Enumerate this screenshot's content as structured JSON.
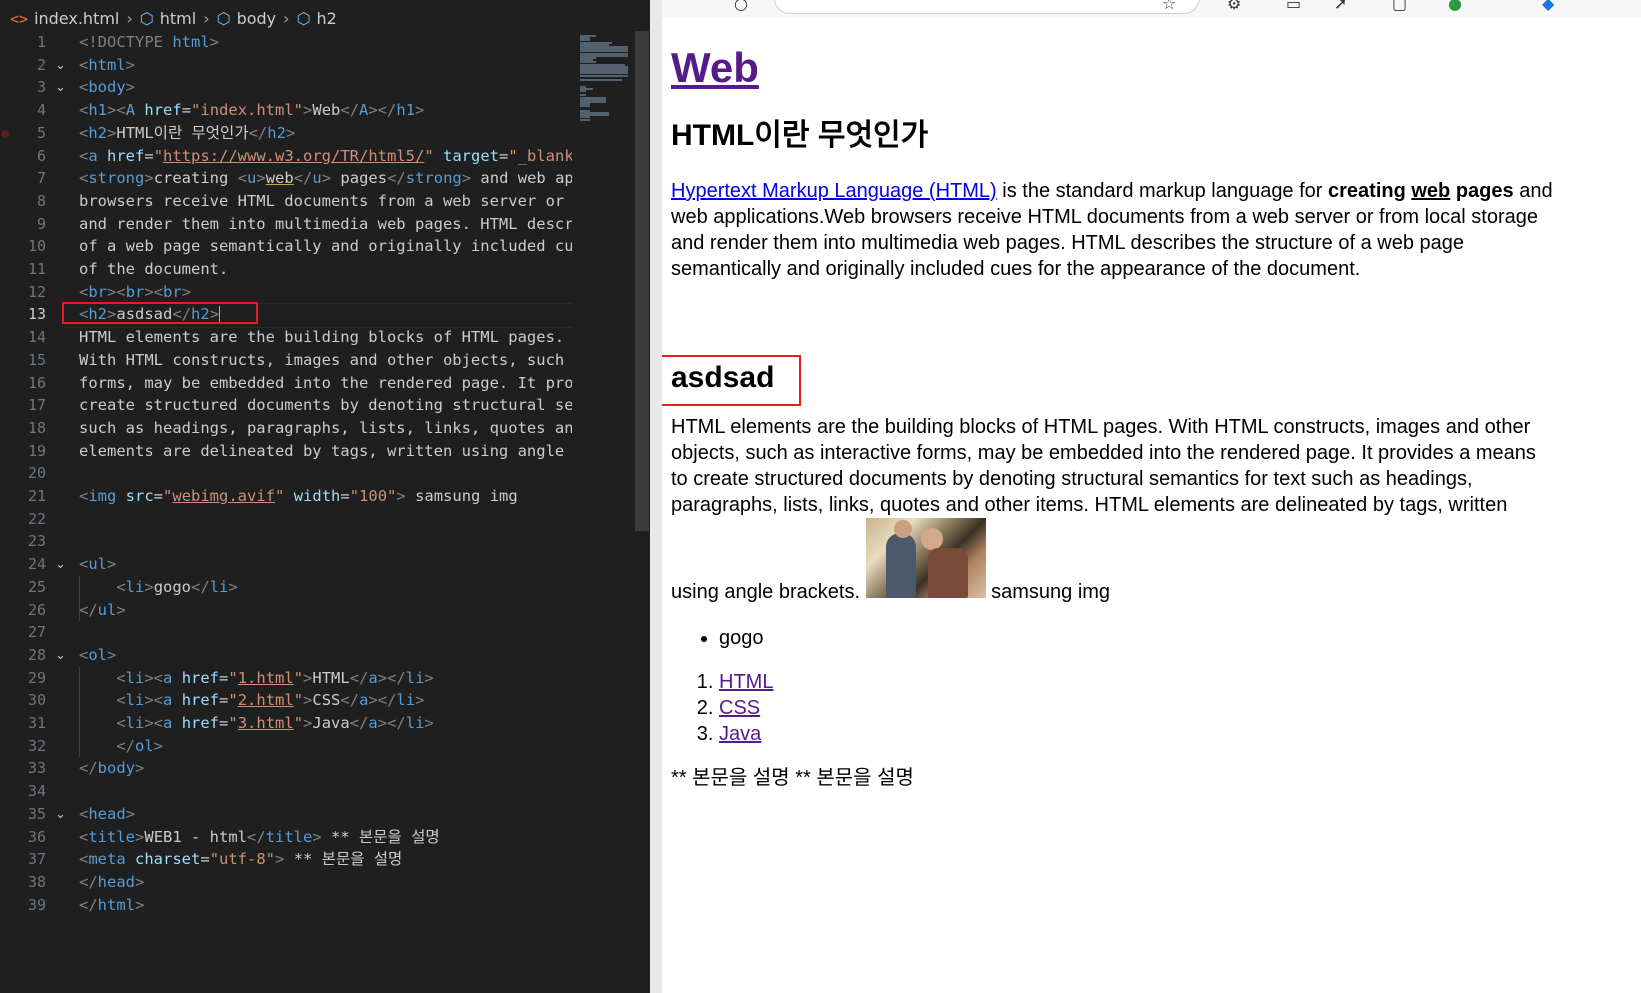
{
  "breadcrumb": [
    "index.html",
    "html",
    "body",
    "h2"
  ],
  "editor": {
    "lines": [
      {
        "n": "1",
        "fold": "",
        "tokens": [
          [
            "brk",
            "<!DOCTYPE "
          ],
          [
            "tag",
            "html"
          ],
          [
            "brk",
            ">"
          ]
        ]
      },
      {
        "n": "2",
        "fold": "v",
        "tokens": [
          [
            "brk",
            "<"
          ],
          [
            "tag",
            "html"
          ],
          [
            "brk",
            ">"
          ]
        ]
      },
      {
        "n": "3",
        "fold": "v",
        "tokens": [
          [
            "brk",
            "<"
          ],
          [
            "tag",
            "body"
          ],
          [
            "brk",
            ">"
          ]
        ]
      },
      {
        "n": "4",
        "fold": "",
        "tokens": [
          [
            "brk",
            "<"
          ],
          [
            "tag",
            "h1"
          ],
          [
            "brk",
            "><"
          ],
          [
            "tag",
            "A "
          ],
          [
            "attr",
            "href"
          ],
          [
            "txt",
            "="
          ],
          [
            "str",
            "\"index.html\""
          ],
          [
            "brk",
            ">"
          ],
          [
            "txt",
            "Web"
          ],
          [
            "brk",
            "</"
          ],
          [
            "tag",
            "A"
          ],
          [
            "brk",
            "></"
          ],
          [
            "tag",
            "h1"
          ],
          [
            "brk",
            ">"
          ]
        ]
      },
      {
        "n": "5",
        "fold": "",
        "bp": true,
        "tokens": [
          [
            "brk",
            "<"
          ],
          [
            "tag",
            "h2"
          ],
          [
            "brk",
            ">"
          ],
          [
            "txt",
            "HTML이란 무엇인가"
          ],
          [
            "brk",
            "</"
          ],
          [
            "tag",
            "h2"
          ],
          [
            "brk",
            ">"
          ]
        ]
      },
      {
        "n": "6",
        "fold": "",
        "tokens": [
          [
            "brk",
            "<"
          ],
          [
            "tag",
            "a "
          ],
          [
            "attr",
            "href"
          ],
          [
            "txt",
            "="
          ],
          [
            "str",
            "\""
          ],
          [
            "link",
            "https://www.w3.org/TR/html5/"
          ],
          [
            "str",
            "\""
          ],
          [
            "txt",
            " "
          ],
          [
            "attr",
            "target"
          ],
          [
            "txt",
            "="
          ],
          [
            "str",
            "\"_blank\""
          ]
        ]
      },
      {
        "n": "7",
        "fold": "",
        "tokens": [
          [
            "brk",
            "<"
          ],
          [
            "tag",
            "strong"
          ],
          [
            "brk",
            ">"
          ],
          [
            "txt",
            "creating "
          ],
          [
            "brk",
            "<"
          ],
          [
            "tag",
            "u"
          ],
          [
            "brk",
            ">"
          ],
          [
            "ul",
            "web"
          ],
          [
            "brk",
            "</"
          ],
          [
            "tag",
            "u"
          ],
          [
            "brk",
            ">"
          ],
          [
            "txt",
            " pages"
          ],
          [
            "brk",
            "</"
          ],
          [
            "tag",
            "strong"
          ],
          [
            "brk",
            ">"
          ],
          [
            "txt",
            " and web app"
          ]
        ]
      },
      {
        "n": "8",
        "fold": "",
        "tokens": [
          [
            "txt",
            "browsers receive HTML documents from a web server or f"
          ]
        ]
      },
      {
        "n": "9",
        "fold": "",
        "tokens": [
          [
            "txt",
            "and render them into multimedia web pages. HTML descri"
          ]
        ]
      },
      {
        "n": "10",
        "fold": "",
        "tokens": [
          [
            "txt",
            "of a web page semantically and originally included cue"
          ]
        ]
      },
      {
        "n": "11",
        "fold": "",
        "tokens": [
          [
            "txt",
            "of the document."
          ]
        ]
      },
      {
        "n": "12",
        "fold": "",
        "tokens": [
          [
            "brk",
            "<"
          ],
          [
            "tag",
            "br"
          ],
          [
            "brk",
            "><"
          ],
          [
            "tag",
            "br"
          ],
          [
            "brk",
            "><"
          ],
          [
            "tag",
            "br"
          ],
          [
            "brk",
            ">"
          ]
        ]
      },
      {
        "n": "13",
        "fold": "",
        "active": true,
        "tokens": [
          [
            "brk",
            "<"
          ],
          [
            "tag",
            "h2"
          ],
          [
            "brk",
            ">"
          ],
          [
            "txt",
            "asdsad"
          ],
          [
            "brk",
            "</"
          ],
          [
            "tag",
            "h2"
          ],
          [
            "brk",
            ">"
          ]
        ]
      },
      {
        "n": "14",
        "fold": "",
        "tokens": [
          [
            "txt",
            "HTML elements are the building blocks of HTML pages."
          ]
        ]
      },
      {
        "n": "15",
        "fold": "",
        "tokens": [
          [
            "txt",
            "With HTML constructs, images and other objects, such a"
          ]
        ]
      },
      {
        "n": "16",
        "fold": "",
        "tokens": [
          [
            "txt",
            "forms, may be embedded into the rendered page. It prov"
          ]
        ]
      },
      {
        "n": "17",
        "fold": "",
        "tokens": [
          [
            "txt",
            "create structured documents by denoting structural sem"
          ]
        ]
      },
      {
        "n": "18",
        "fold": "",
        "tokens": [
          [
            "txt",
            "such as headings, paragraphs, lists, links, quotes and"
          ]
        ]
      },
      {
        "n": "19",
        "fold": "",
        "tokens": [
          [
            "txt",
            "elements are delineated by tags, written using angle b"
          ]
        ]
      },
      {
        "n": "20",
        "fold": "",
        "tokens": []
      },
      {
        "n": "21",
        "fold": "",
        "tokens": [
          [
            "brk",
            "<"
          ],
          [
            "tag",
            "img "
          ],
          [
            "attr",
            "src"
          ],
          [
            "txt",
            "="
          ],
          [
            "str",
            "\""
          ],
          [
            "link",
            "webimg.avif"
          ],
          [
            "str",
            "\""
          ],
          [
            "txt",
            " "
          ],
          [
            "attr",
            "width"
          ],
          [
            "txt",
            "="
          ],
          [
            "str",
            "\"100\""
          ],
          [
            "brk",
            ">"
          ],
          [
            "txt",
            " samsung img"
          ]
        ]
      },
      {
        "n": "22",
        "fold": "",
        "tokens": []
      },
      {
        "n": "23",
        "fold": "",
        "tokens": []
      },
      {
        "n": "24",
        "fold": "v",
        "tokens": [
          [
            "brk",
            "<"
          ],
          [
            "tag",
            "ul"
          ],
          [
            "brk",
            ">"
          ]
        ]
      },
      {
        "n": "25",
        "fold": "",
        "tokens": [
          [
            "txt",
            "    "
          ],
          [
            "brk",
            "<"
          ],
          [
            "tag",
            "li"
          ],
          [
            "brk",
            ">"
          ],
          [
            "txt",
            "gogo"
          ],
          [
            "brk",
            "</"
          ],
          [
            "tag",
            "li"
          ],
          [
            "brk",
            ">"
          ]
        ]
      },
      {
        "n": "26",
        "fold": "",
        "tokens": [
          [
            "brk",
            "</"
          ],
          [
            "tag",
            "ul"
          ],
          [
            "brk",
            ">"
          ]
        ]
      },
      {
        "n": "27",
        "fold": "",
        "tokens": []
      },
      {
        "n": "28",
        "fold": "v",
        "tokens": [
          [
            "brk",
            "<"
          ],
          [
            "tag",
            "ol"
          ],
          [
            "brk",
            ">"
          ]
        ]
      },
      {
        "n": "29",
        "fold": "",
        "tokens": [
          [
            "txt",
            "    "
          ],
          [
            "brk",
            "<"
          ],
          [
            "tag",
            "li"
          ],
          [
            "brk",
            "><"
          ],
          [
            "tag",
            "a "
          ],
          [
            "attr",
            "href"
          ],
          [
            "txt",
            "="
          ],
          [
            "str",
            "\""
          ],
          [
            "link",
            "1.html"
          ],
          [
            "str",
            "\""
          ],
          [
            "brk",
            ">"
          ],
          [
            "txt",
            "HTML"
          ],
          [
            "brk",
            "</"
          ],
          [
            "tag",
            "a"
          ],
          [
            "brk",
            "></"
          ],
          [
            "tag",
            "li"
          ],
          [
            "brk",
            ">"
          ]
        ]
      },
      {
        "n": "30",
        "fold": "",
        "tokens": [
          [
            "txt",
            "    "
          ],
          [
            "brk",
            "<"
          ],
          [
            "tag",
            "li"
          ],
          [
            "brk",
            "><"
          ],
          [
            "tag",
            "a "
          ],
          [
            "attr",
            "href"
          ],
          [
            "txt",
            "="
          ],
          [
            "str",
            "\""
          ],
          [
            "link",
            "2.html"
          ],
          [
            "str",
            "\""
          ],
          [
            "brk",
            ">"
          ],
          [
            "txt",
            "CSS"
          ],
          [
            "brk",
            "</"
          ],
          [
            "tag",
            "a"
          ],
          [
            "brk",
            "></"
          ],
          [
            "tag",
            "li"
          ],
          [
            "brk",
            ">"
          ]
        ]
      },
      {
        "n": "31",
        "fold": "",
        "tokens": [
          [
            "txt",
            "    "
          ],
          [
            "brk",
            "<"
          ],
          [
            "tag",
            "li"
          ],
          [
            "brk",
            "><"
          ],
          [
            "tag",
            "a "
          ],
          [
            "attr",
            "href"
          ],
          [
            "txt",
            "="
          ],
          [
            "str",
            "\""
          ],
          [
            "link",
            "3.html"
          ],
          [
            "str",
            "\""
          ],
          [
            "brk",
            ">"
          ],
          [
            "txt",
            "Java"
          ],
          [
            "brk",
            "</"
          ],
          [
            "tag",
            "a"
          ],
          [
            "brk",
            "></"
          ],
          [
            "tag",
            "li"
          ],
          [
            "brk",
            ">"
          ]
        ]
      },
      {
        "n": "32",
        "fold": "",
        "tokens": [
          [
            "txt",
            "    "
          ],
          [
            "brk",
            "</"
          ],
          [
            "tag",
            "ol"
          ],
          [
            "brk",
            ">"
          ]
        ]
      },
      {
        "n": "33",
        "fold": "",
        "tokens": [
          [
            "brk",
            "</"
          ],
          [
            "tag",
            "body"
          ],
          [
            "brk",
            ">"
          ]
        ]
      },
      {
        "n": "34",
        "fold": "",
        "tokens": []
      },
      {
        "n": "35",
        "fold": "v",
        "tokens": [
          [
            "brk",
            "<"
          ],
          [
            "tag",
            "head"
          ],
          [
            "brk",
            ">"
          ]
        ]
      },
      {
        "n": "36",
        "fold": "",
        "tokens": [
          [
            "brk",
            "<"
          ],
          [
            "tag",
            "title"
          ],
          [
            "brk",
            ">"
          ],
          [
            "txt",
            "WEB1 - html"
          ],
          [
            "brk",
            "</"
          ],
          [
            "tag",
            "title"
          ],
          [
            "brk",
            ">"
          ],
          [
            "txt",
            " ** 본문을 설명"
          ]
        ]
      },
      {
        "n": "37",
        "fold": "",
        "tokens": [
          [
            "brk",
            "<"
          ],
          [
            "tag",
            "meta "
          ],
          [
            "attr",
            "charset"
          ],
          [
            "txt",
            "="
          ],
          [
            "str",
            "\"utf-8\""
          ],
          [
            "brk",
            ">"
          ],
          [
            "txt",
            " ** 본문을 설명"
          ]
        ]
      },
      {
        "n": "38",
        "fold": "",
        "tokens": [
          [
            "brk",
            "</"
          ],
          [
            "tag",
            "head"
          ],
          [
            "brk",
            ">"
          ]
        ]
      },
      {
        "n": "39",
        "fold": "",
        "tokens": [
          [
            "brk",
            "</"
          ],
          [
            "tag",
            "html"
          ],
          [
            "brk",
            ">"
          ]
        ]
      }
    ]
  },
  "preview": {
    "h1": "Web",
    "h2_title": "HTML이란 무엇인가",
    "link_text": "Hypertext Markup Language (HTML)",
    "p1_after_link": " is the standard markup language for ",
    "p1_strong_a": "creating ",
    "p1_strong_u": "web",
    "p1_strong_b": " pages",
    "p1_rest": " and web applications.Web browsers receive HTML documents from a web server or from local storage and render them into multimedia web pages. HTML describes the structure of a web page semantically and originally included cues for the appearance of the document.",
    "h2_asdsad": "asdsad",
    "p2": "HTML elements are the building blocks of HTML pages. With HTML constructs, images and other objects, such as interactive forms, may be embedded into the rendered page. It provides a means to create structured documents by denoting structural semantics for text such as headings, paragraphs, lists, links, quotes and other items. HTML elements are delineated by tags, written using angle brackets. ",
    "img_caption": " samsung img",
    "ul_items": [
      "gogo"
    ],
    "ol_items": [
      "HTML",
      "CSS",
      "Java"
    ],
    "footer": "** 본문을 설명 ** 본문을 설명"
  },
  "colors": {
    "highlight": "#e51f1f",
    "visited": "#551a8b",
    "link": "#0000ee"
  }
}
